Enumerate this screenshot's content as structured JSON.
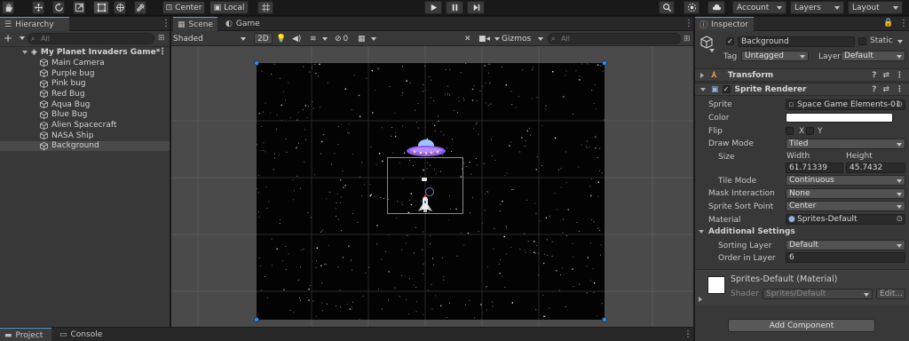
{
  "toolbar": {
    "tools": [
      "hand-tool",
      "move-tool",
      "rotate-tool",
      "scale-tool",
      "rect-tool",
      "transform-tool",
      "custom-tool"
    ],
    "active_tool": "rect-tool",
    "pivot_label": "Center",
    "space_label": "Local",
    "account_label": "Account",
    "layers_label": "Layers",
    "layout_label": "Layout"
  },
  "hierarchy": {
    "tab_label": "Hierarchy",
    "search_placeholder": "All",
    "scene_name": "My Planet Invaders Game*",
    "items": [
      {
        "label": "Main Camera"
      },
      {
        "label": "Purple bug"
      },
      {
        "label": "Pink bug"
      },
      {
        "label": "Red Bug"
      },
      {
        "label": "Aqua Bug"
      },
      {
        "label": "Blue Bug"
      },
      {
        "label": "Alien Spacecraft"
      },
      {
        "label": "NASA Ship"
      },
      {
        "label": "Background"
      }
    ],
    "selected_item": "Background"
  },
  "scene": {
    "tabs": [
      {
        "label": "Scene"
      },
      {
        "label": "Game"
      }
    ],
    "active_tab": "Scene",
    "shading_mode": "Shaded",
    "mode_2d_label": "2D",
    "hidden_count": "0",
    "gizmos_label": "Gizmos",
    "search_placeholder": "All"
  },
  "inspector": {
    "tab_label": "Inspector",
    "object_name": "Background",
    "static_label": "Static",
    "tag_label": "Tag",
    "tag_value": "Untagged",
    "layer_label": "Layer",
    "layer_value": "Default",
    "transform_label": "Transform",
    "sprite_renderer_label": "Sprite Renderer",
    "sprite_label": "Sprite",
    "sprite_value": "Space Game Elements-01",
    "color_label": "Color",
    "color_value": "#ffffff",
    "flip_label": "Flip",
    "flip_x": "X",
    "flip_y": "Y",
    "draw_mode_label": "Draw Mode",
    "draw_mode_value": "Tiled",
    "size_label": "Size",
    "width_label": "Width",
    "height_label": "Height",
    "width_value": "61.71339",
    "height_value": "45.7432",
    "tile_mode_label": "Tile Mode",
    "tile_mode_value": "Continuous",
    "mask_interaction_label": "Mask Interaction",
    "mask_interaction_value": "None",
    "sprite_sort_point_label": "Sprite Sort Point",
    "sprite_sort_point_value": "Center",
    "material_label": "Material",
    "material_value": "Sprites-Default",
    "additional_settings_label": "Additional Settings",
    "sorting_layer_label": "Sorting Layer",
    "sorting_layer_value": "Default",
    "order_in_layer_label": "Order in Layer",
    "order_in_layer_value": "6",
    "material_section_title": "Sprites-Default (Material)",
    "shader_label": "Shader",
    "shader_value": "Sprites/Default",
    "edit_label": "Edit...",
    "add_component_label": "Add Component"
  },
  "bottom": {
    "tabs": [
      {
        "label": "Project"
      },
      {
        "label": "Console"
      }
    ]
  },
  "colors": {
    "accent": "#3a8ee6",
    "panel_bg": "#383838",
    "selected_row": "#4a4a4a",
    "space_bg": "#030303"
  }
}
